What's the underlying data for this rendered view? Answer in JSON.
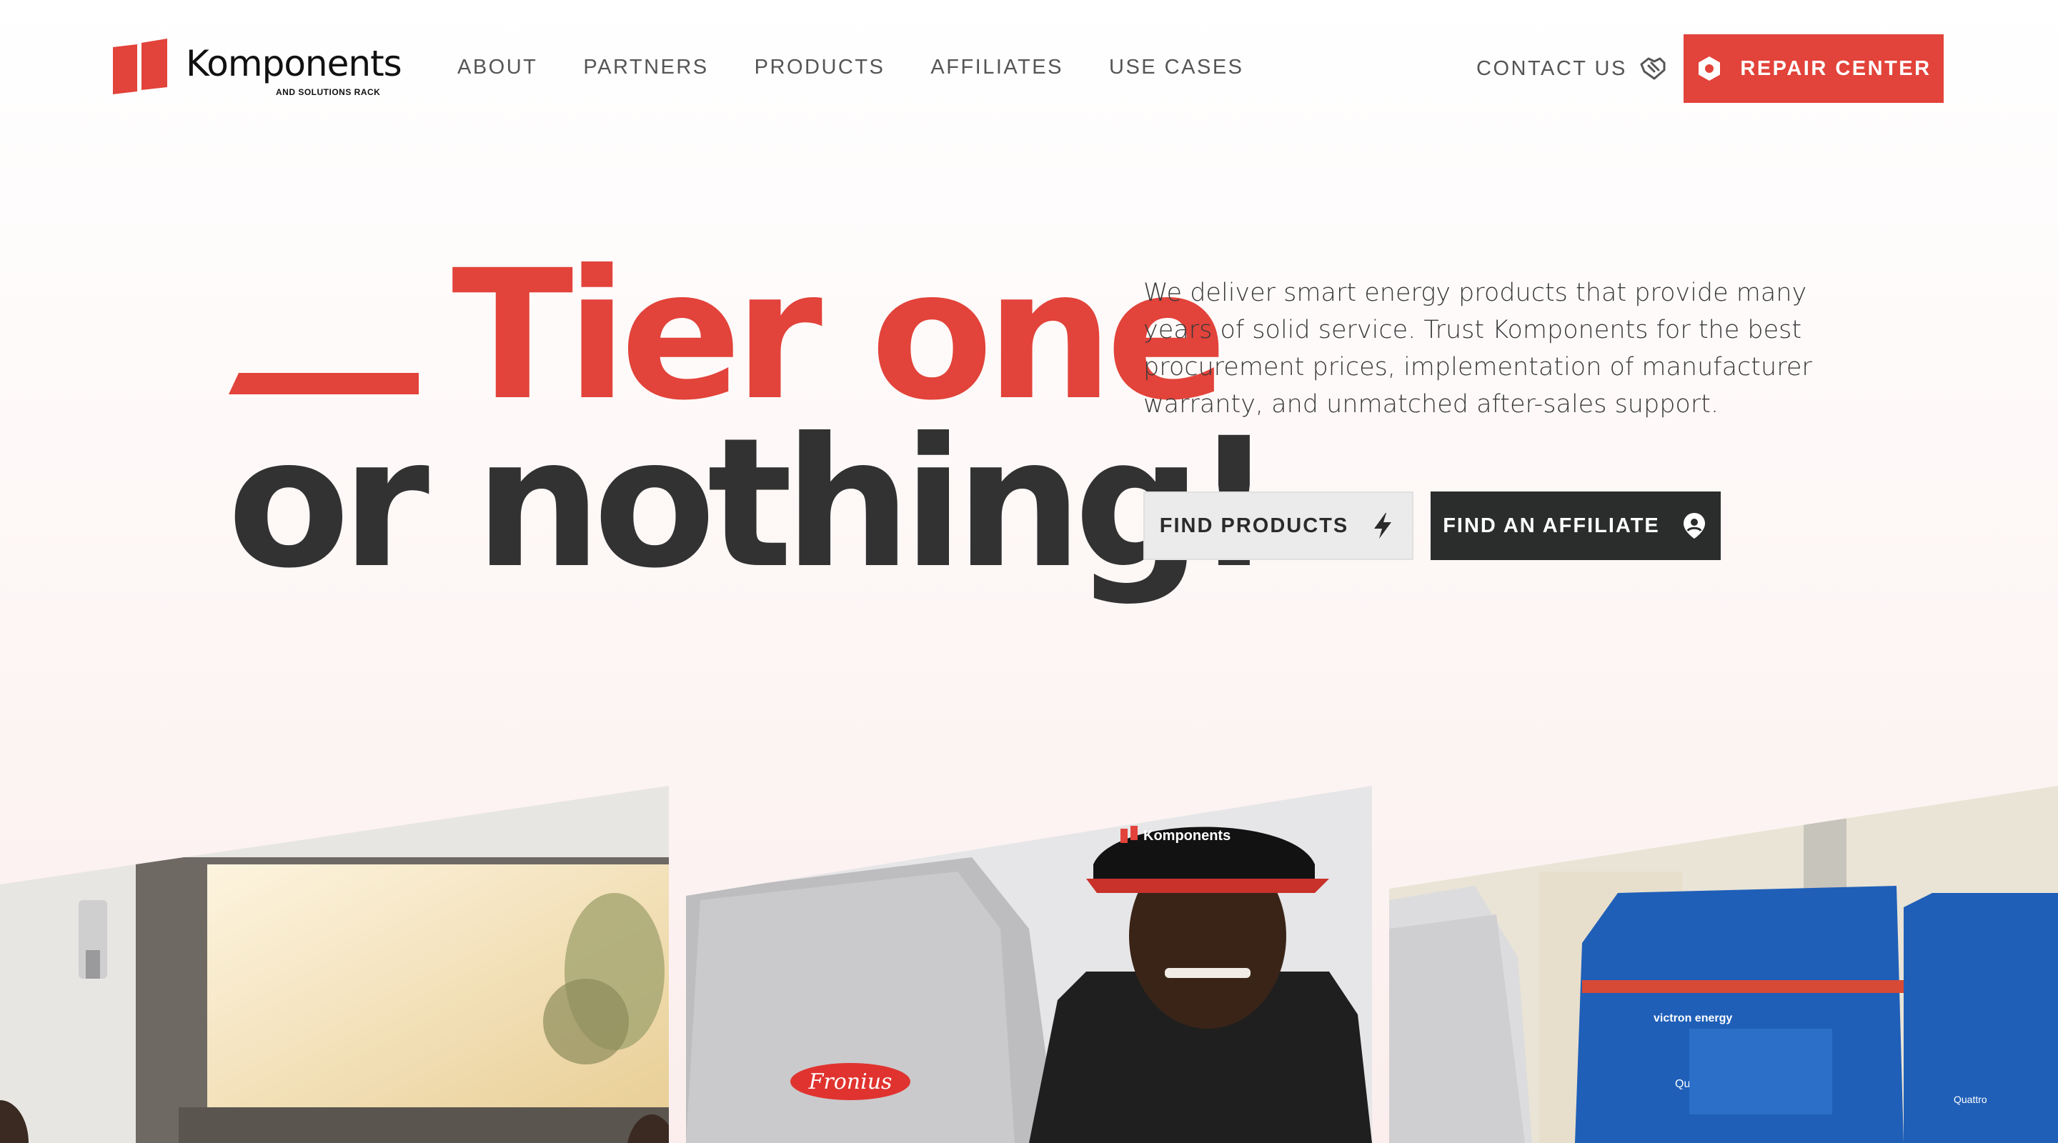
{
  "brand": {
    "name": "Komponents",
    "tagline": "AND SOLUTIONS RACK",
    "accent_color": "#e2433a",
    "dark_color": "#2a2d2c"
  },
  "nav": {
    "items": [
      {
        "label": "ABOUT"
      },
      {
        "label": "PARTNERS"
      },
      {
        "label": "PRODUCTS"
      },
      {
        "label": "AFFILIATES"
      },
      {
        "label": "USE CASES"
      }
    ],
    "contact_label": "CONTACT US",
    "contact_icon": "handshake-icon",
    "repair_label": "REPAIR CENTER",
    "repair_icon": "hexagon-gear-icon"
  },
  "hero": {
    "headline_line1": "Tier one",
    "headline_line2": "or nothing!",
    "intro": "We deliver smart energy products that provide many years of solid service. Trust Komponents for the best procurement prices, implementation of manufacturer warranty, and unmatched after-sales support.",
    "primary_button": {
      "label": "FIND PRODUCTS",
      "icon": "lightning-icon"
    },
    "secondary_button": {
      "label": "FIND AN AFFILIATE",
      "icon": "location-pin-icon"
    }
  },
  "images": [
    {
      "name": "office-window-photo"
    },
    {
      "name": "technician-fronius-photo",
      "inverter_brand": "Fronius",
      "cap_text": "Komponents"
    },
    {
      "name": "victron-quattro-photo",
      "device_brand": "victron energy",
      "device_model": "Quattro"
    }
  ]
}
